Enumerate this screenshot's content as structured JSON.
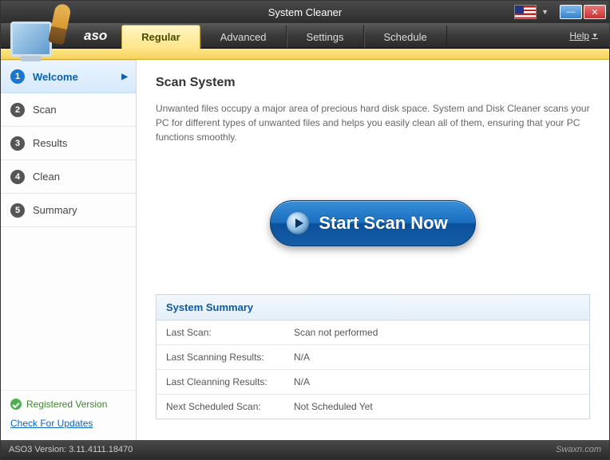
{
  "titlebar": {
    "title": "System Cleaner"
  },
  "menubar": {
    "brand": "aso",
    "tabs": {
      "regular": "Regular",
      "advanced": "Advanced",
      "settings": "Settings",
      "schedule": "Schedule"
    },
    "help": "Help"
  },
  "sidebar": {
    "steps": {
      "welcome": "Welcome",
      "scan": "Scan",
      "results": "Results",
      "clean": "Clean",
      "summary": "Summary"
    },
    "nums": {
      "n1": "1",
      "n2": "2",
      "n3": "3",
      "n4": "4",
      "n5": "5"
    },
    "registered": "Registered Version",
    "updates": "Check For Updates"
  },
  "main": {
    "heading": "Scan System",
    "description": "Unwanted files occupy a major area of precious hard disk space. System and Disk Cleaner scans your PC for different types of unwanted files and helps you easily clean all of them, ensuring that your PC functions smoothly.",
    "scan_button": "Start Scan Now"
  },
  "summary": {
    "title": "System Summary",
    "rows": {
      "last_scan_label": "Last Scan:",
      "last_scan_value": "Scan not performed",
      "last_scanning_label": "Last Scanning Results:",
      "last_scanning_value": "N/A",
      "last_cleaning_label": "Last Cleanning Results:",
      "last_cleaning_value": "N/A",
      "next_scheduled_label": "Next Scheduled Scan:",
      "next_scheduled_value": "Not Scheduled Yet"
    }
  },
  "statusbar": {
    "version": "ASO3 Version: 3.11.4111.18470",
    "watermark": "Swaxn.com"
  }
}
